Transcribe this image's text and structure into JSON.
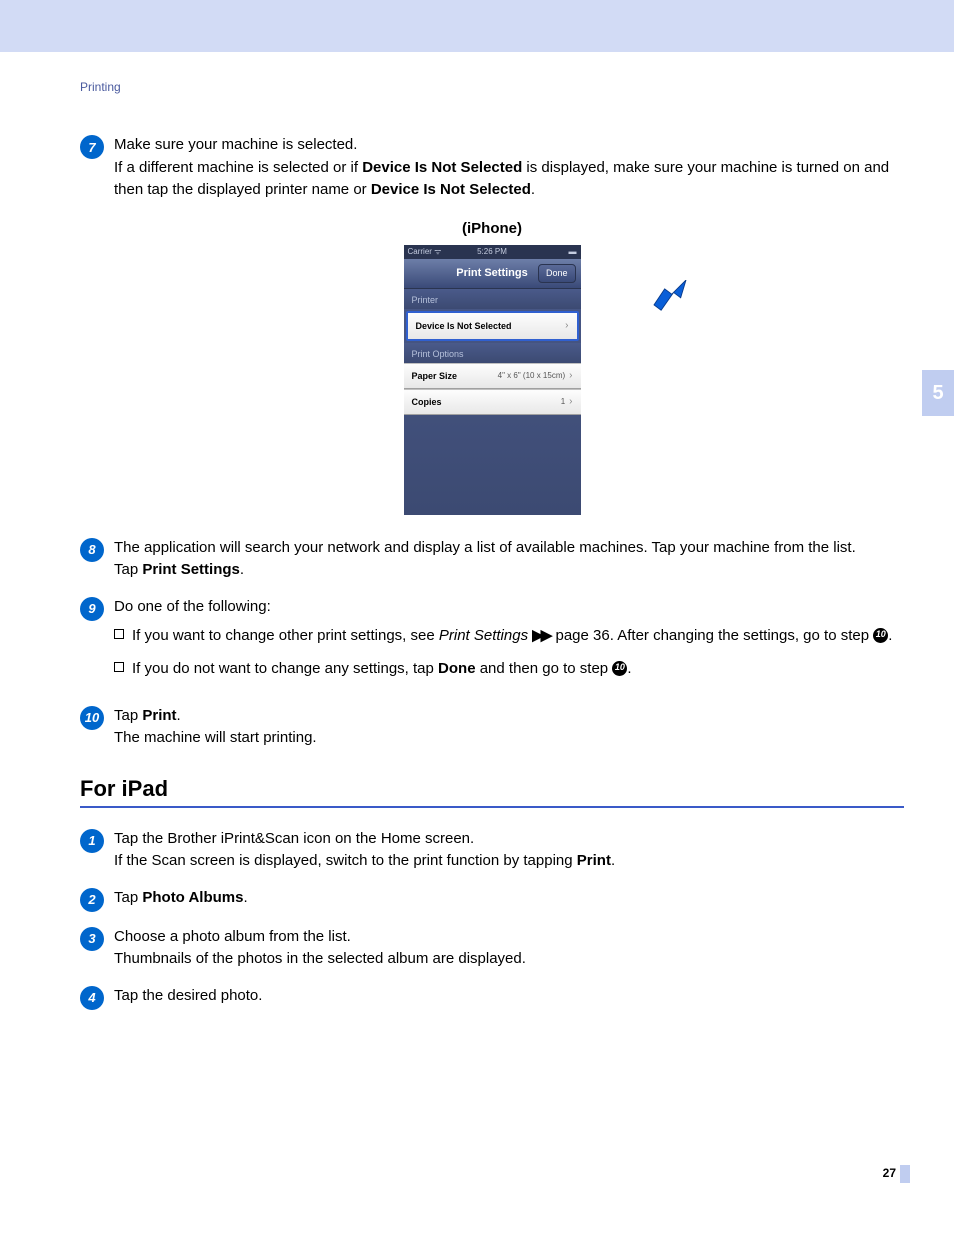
{
  "header": {
    "section": "Printing"
  },
  "sideTab": "5",
  "pageNumber": "27",
  "iphoneCaption": "(iPhone)",
  "iphone": {
    "carrier": "Carrier",
    "time": "5:26 PM",
    "title": "Print Settings",
    "done": "Done",
    "section1": "Printer",
    "printerRow": {
      "label": "Device Is Not Selected"
    },
    "section2": "Print Options",
    "paperRow": {
      "label": "Paper Size",
      "value": "4\" x 6\" (10 x 15cm)"
    },
    "copiesRow": {
      "label": "Copies",
      "value": "1"
    }
  },
  "step7": {
    "num": "7",
    "l1": "Make sure your machine is selected.",
    "l2a": "If a different machine is selected or if ",
    "l2b": "Device Is Not Selected",
    "l2c": " is displayed, make sure your machine is turned on and then tap the displayed printer name or ",
    "l2d": "Device Is Not Selected",
    "l2e": "."
  },
  "step8": {
    "num": "8",
    "l1": "The application will search your network and display a list of available machines. Tap your machine from the list.",
    "l2a": "Tap ",
    "l2b": "Print Settings",
    "l2c": "."
  },
  "step9": {
    "num": "9",
    "l1": "Do one of the following:",
    "b1a": "If you want to change other print settings, see ",
    "b1b": "Print Settings",
    "b1c": " page 36. After changing the settings, go to step ",
    "b1ref": "10",
    "b1d": ".",
    "b2a": "If you do not want to change any settings, tap ",
    "b2b": "Done",
    "b2c": " and then go to step ",
    "b2ref": "10",
    "b2d": "."
  },
  "step10": {
    "num": "10",
    "l1a": "Tap ",
    "l1b": "Print",
    "l1c": ".",
    "l2": "The machine will start printing."
  },
  "h2": "For iPad",
  "ipad": {
    "s1": {
      "num": "1",
      "l1": "Tap the Brother iPrint&Scan icon on the Home screen.",
      "l2a": "If the Scan screen is displayed, switch to the print function by tapping ",
      "l2b": "Print",
      "l2c": "."
    },
    "s2": {
      "num": "2",
      "l1a": "Tap ",
      "l1b": "Photo Albums",
      "l1c": "."
    },
    "s3": {
      "num": "3",
      "l1": "Choose a photo album from the list.",
      "l2": "Thumbnails of the photos in the selected album are displayed."
    },
    "s4": {
      "num": "4",
      "l1": "Tap the desired photo."
    }
  }
}
